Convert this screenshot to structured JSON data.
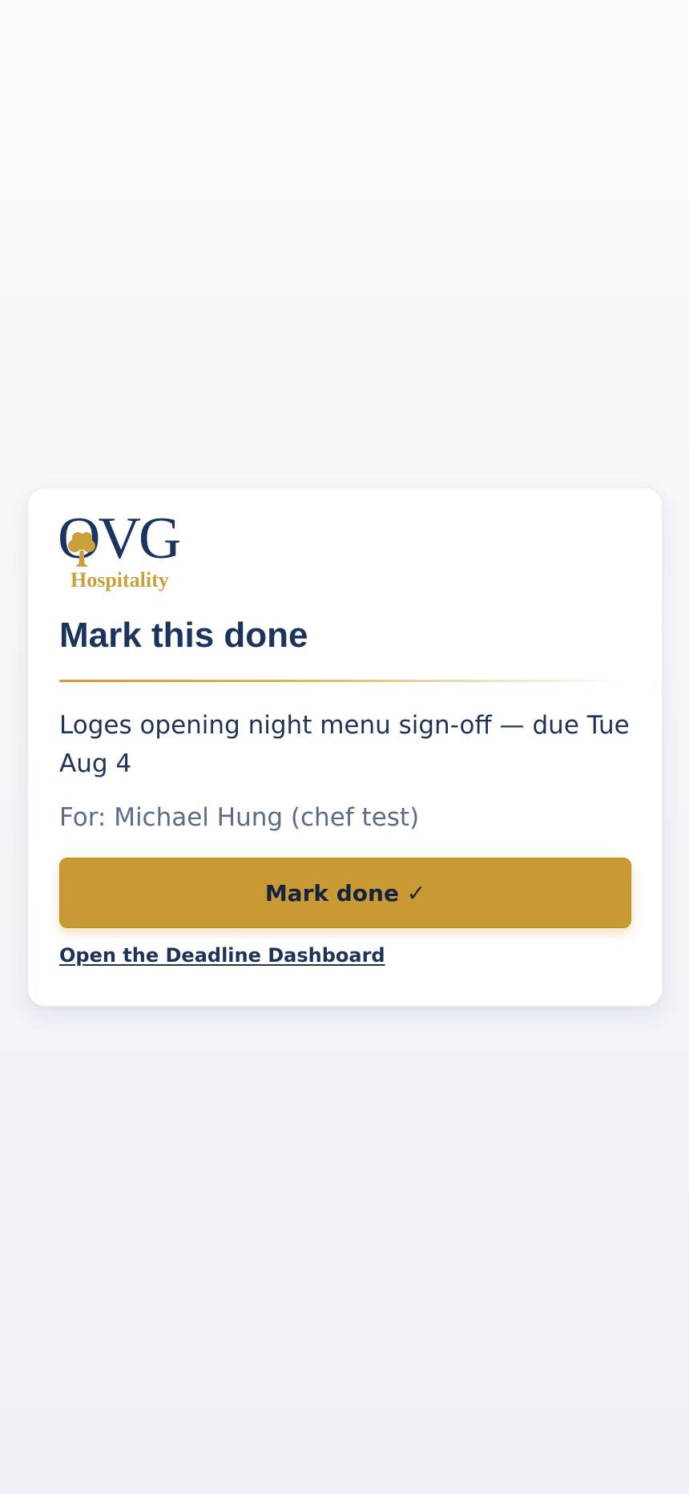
{
  "logo": {
    "brand": "OVG",
    "tagline": "Hospitality",
    "colors": {
      "navy": "#1b335f",
      "gold": "#c9a03a"
    }
  },
  "card": {
    "title": "Mark this done",
    "task": "Loges opening night menu sign-off — due Tue Aug 4",
    "for_line": "For: Michael Hung (chef test)",
    "done_button_label": "Mark done ✓",
    "dashboard_link": "Open the Deadline Dashboard"
  },
  "colors": {
    "accent": "#c99a34",
    "text": "#1f3358",
    "muted": "#5e6b85"
  }
}
